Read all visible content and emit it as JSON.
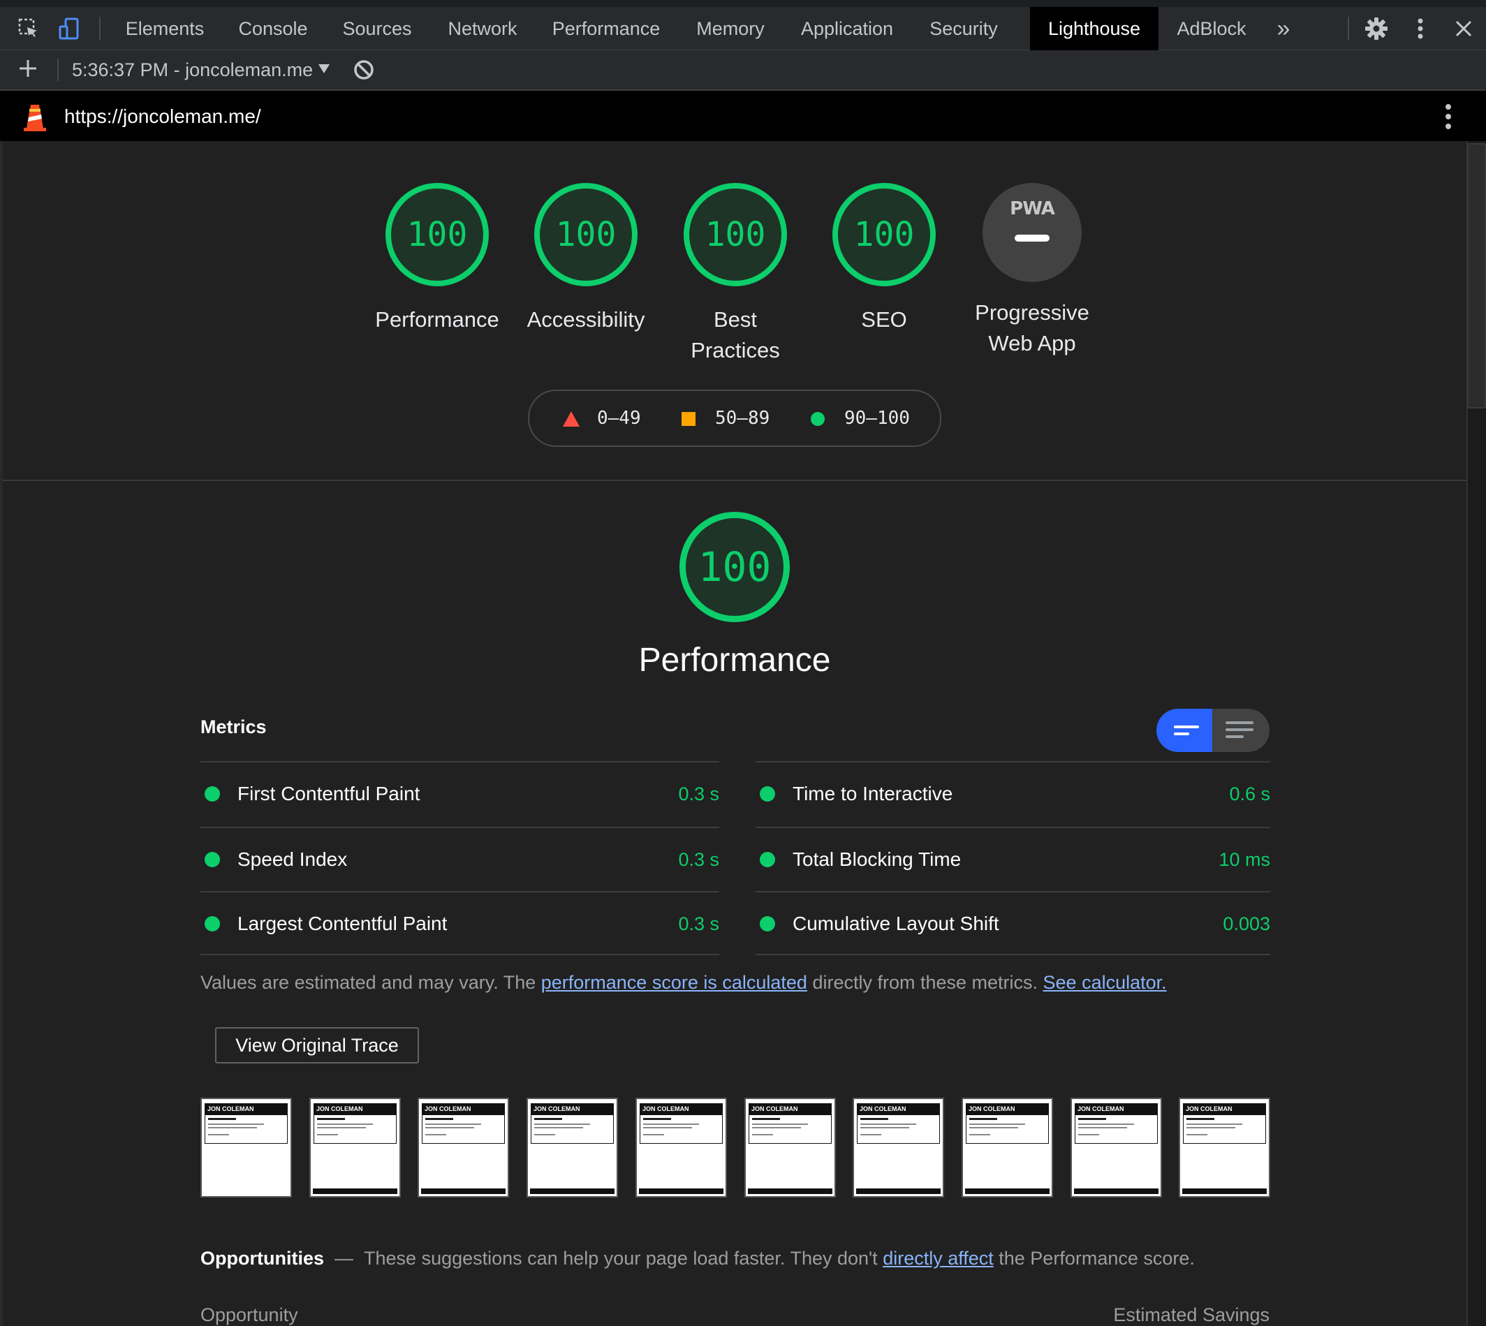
{
  "devtools": {
    "tabs": [
      "Elements",
      "Console",
      "Sources",
      "Network",
      "Performance",
      "Memory",
      "Application",
      "Security",
      "Lighthouse",
      "AdBlock"
    ],
    "active_tab": "Lighthouse",
    "more_tabs_label": "»",
    "report_selector": "5:36:37 PM - joncoleman.me"
  },
  "report": {
    "url": "https://joncoleman.me/",
    "gauges": [
      {
        "score": "100",
        "label": "Performance"
      },
      {
        "score": "100",
        "label": "Accessibility"
      },
      {
        "score": "100",
        "label": "Best Practices"
      },
      {
        "score": "100",
        "label": "SEO"
      },
      {
        "score": "",
        "label": "Progressive Web App",
        "badge": "PWA"
      }
    ],
    "legend": [
      {
        "range": "0–49",
        "shape": "triangle",
        "color": "#ff4e42"
      },
      {
        "range": "50–89",
        "shape": "square",
        "color": "#ffa400"
      },
      {
        "range": "90–100",
        "shape": "circle",
        "color": "#0cce6b"
      }
    ],
    "performance": {
      "score": "100",
      "title": "Performance",
      "metrics_heading": "Metrics",
      "metrics": [
        {
          "name": "First Contentful Paint",
          "value": "0.3 s"
        },
        {
          "name": "Time to Interactive",
          "value": "0.6 s"
        },
        {
          "name": "Speed Index",
          "value": "0.3 s"
        },
        {
          "name": "Total Blocking Time",
          "value": "10 ms"
        },
        {
          "name": "Largest Contentful Paint",
          "value": "0.3 s"
        },
        {
          "name": "Cumulative Layout Shift",
          "value": "0.003"
        }
      ],
      "note_prefix": "Values are estimated and may vary. The ",
      "note_link1": "performance score is calculated",
      "note_middle": " directly from these metrics. ",
      "note_link2": "See calculator.",
      "trace_button": "View Original Trace",
      "filmstrip_site_name": "JON COLEMAN",
      "filmstrip_frames": 10
    },
    "opportunities": {
      "heading": "Opportunities",
      "dash": "—",
      "desc_prefix": "These suggestions can help your page load faster. They don't ",
      "desc_link": "directly affect",
      "desc_suffix": " the Performance score.",
      "col_opportunity": "Opportunity",
      "col_savings": "Estimated Savings"
    }
  },
  "colors": {
    "pass": "#0cce6b",
    "average": "#ffa400",
    "fail": "#ff4e42",
    "toggle_active": "#2962ff",
    "link": "#8ab4f8"
  }
}
